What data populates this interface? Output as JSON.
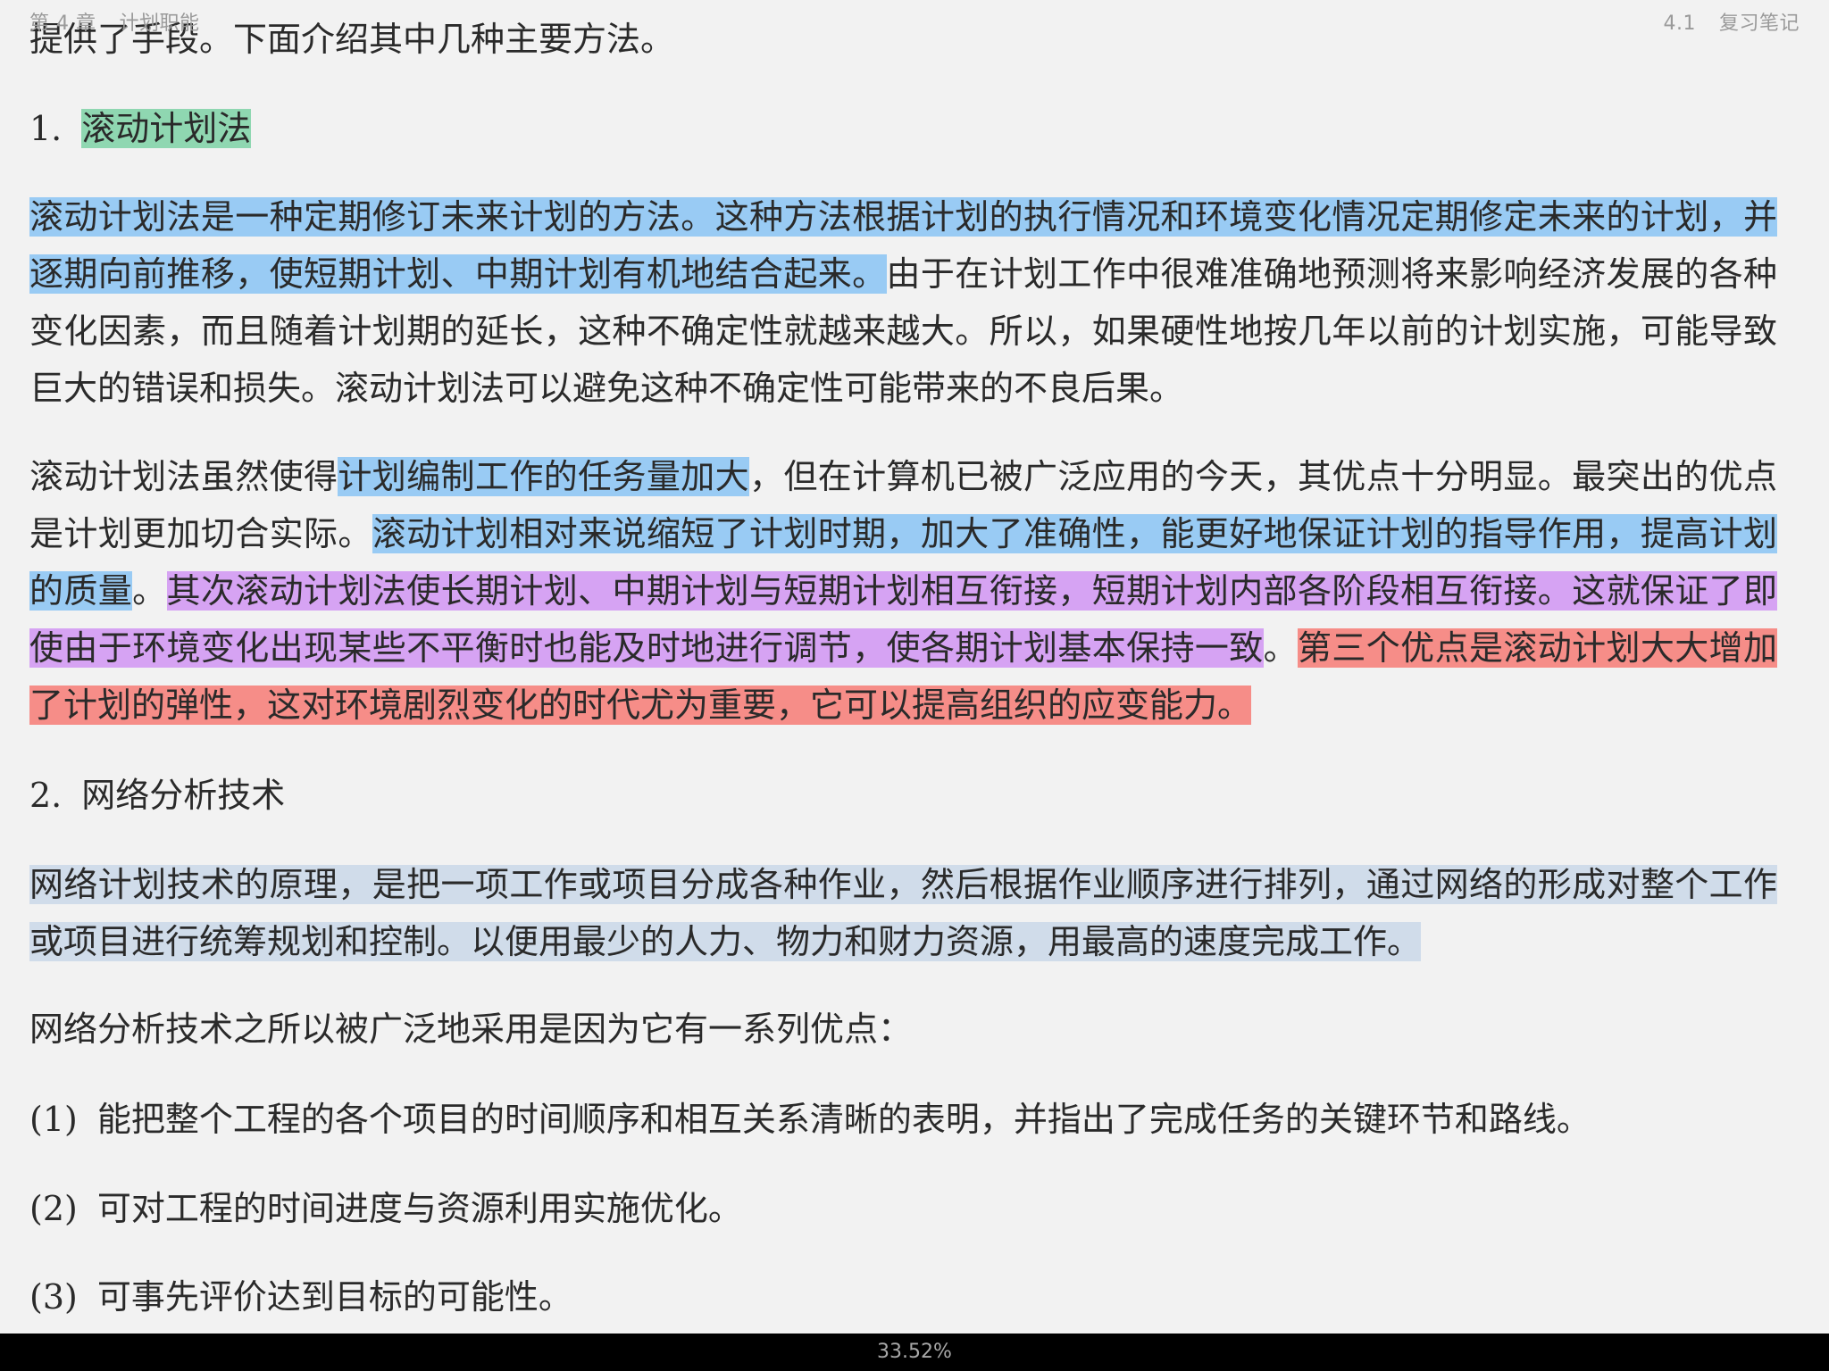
{
  "header": {
    "chapter_number": "第 4 章",
    "chapter_title": "计划职能",
    "section_number": "4.1",
    "section_title": "复习笔记"
  },
  "clipped_top_line": "提供了手段。下面介绍其中几种主要方法。",
  "section1": {
    "number": "1.",
    "title": "滚动计划法"
  },
  "para1": {
    "hl_blue": "滚动计划法是一种定期修订未来计划的方法。这种方法根据计划的执行情况和环境变化情况定期修定未来的计划，并逐期向前推移，使短期计划、中期计划有机地结合起来。",
    "plain": "由于在计划工作中很难准确地预测将来影响经济发展的各种变化因素，而且随着计划期的延长，这种不确定性就越来越大。所以，如果硬性地按几年以前的计划实施，可能导致巨大的错误和损失。滚动计划法可以避免这种不确定性可能带来的不良后果。"
  },
  "para2": {
    "plain1": "滚动计划法虽然使得",
    "hl_blue1": "计划编制工作的任务量加大",
    "plain2": "，但在计算机已被广泛应用的今天，其优点十分明显。最突出的优点是计划更加切合实际。",
    "hl_blue2": "滚动计划相对来说缩短了计划时期，加大了准确性，能更好地保证计划的指导作用，提高计划的质量",
    "plain3": "。",
    "hl_purple": "其次滚动计划法使长期计划、中期计划与短期计划相互衔接，短期计划内部各阶段相互衔接。这就保证了即使由于环境变化出现某些不平衡时也能及时地进行调节，使各期计划基本保持一致",
    "plain4": "。",
    "hl_red": "第三个优点是滚动计划大大增加了计划的弹性，这对环境剧烈变化的时代尤为重要，它可以提高组织的应变能力。"
  },
  "section2": {
    "number": "2.",
    "title": "网络分析技术"
  },
  "para3": {
    "hl_gray": "网络计划技术的原理，是把一项工作或项目分成各种作业，然后根据作业顺序进行排列，通过网络的形成对整个工作或项目进行统筹规划和控制。以便用最少的人力、物力和财力资源，用最高的速度完成工作。"
  },
  "para4": "网络分析技术之所以被广泛地采用是因为它有一系列优点：",
  "list": [
    {
      "marker": "(1)",
      "text": "能把整个工程的各个项目的时间顺序和相互关系清晰的表明，并指出了完成任务的关键环节和路线。"
    },
    {
      "marker": "(2)",
      "text": "可对工程的时间进度与资源利用实施优化。"
    },
    {
      "marker": "(3)",
      "text": "可事先评价达到目标的可能性。"
    }
  ],
  "footer": {
    "progress": "33.52%"
  }
}
